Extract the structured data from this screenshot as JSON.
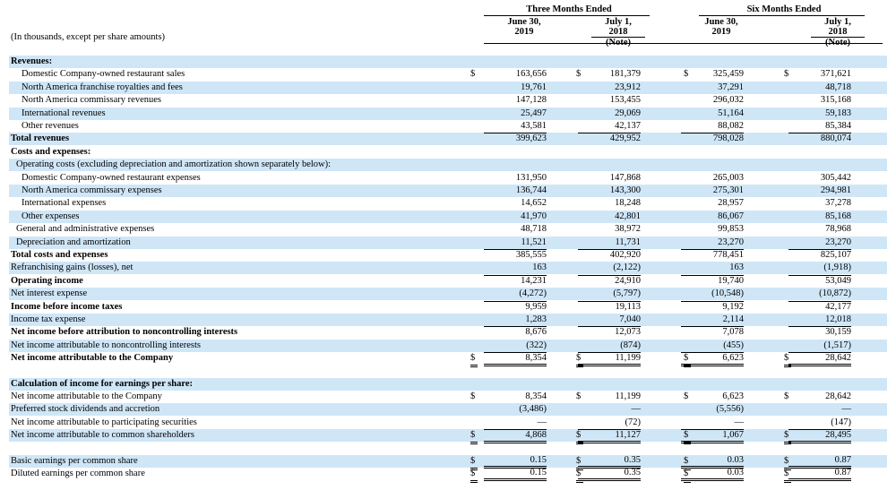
{
  "header": {
    "units": "(In thousands, except per share amounts)",
    "three_months": "Three Months Ended",
    "six_months": "Six Months Ended",
    "col1": [
      "June 30,",
      "2019",
      ""
    ],
    "col2": [
      "July 1,",
      "2018",
      "(Note)"
    ],
    "col3": [
      "June 30,",
      "2019",
      ""
    ],
    "col4": [
      "July 1,",
      "2018",
      "(Note)"
    ]
  },
  "rows": [
    {
      "label": "Revenues:",
      "indent": 0,
      "bold": true,
      "shade": true,
      "values": [
        "",
        "",
        "",
        ""
      ]
    },
    {
      "label": "Domestic Company-owned restaurant sales",
      "indent": 2,
      "shade": false,
      "dollar": true,
      "values": [
        "163,656",
        "181,379",
        "325,459",
        "371,621"
      ]
    },
    {
      "label": "North America franchise royalties and fees",
      "indent": 2,
      "shade": true,
      "values": [
        "19,761",
        "23,912",
        "37,291",
        "48,718"
      ]
    },
    {
      "label": "North America commissary revenues",
      "indent": 2,
      "shade": false,
      "values": [
        "147,128",
        "153,455",
        "296,032",
        "315,168"
      ]
    },
    {
      "label": "International revenues",
      "indent": 2,
      "shade": true,
      "values": [
        "25,497",
        "29,069",
        "51,164",
        "59,183"
      ]
    },
    {
      "label": "Other revenues",
      "indent": 2,
      "shade": false,
      "values": [
        "43,581",
        "42,137",
        "88,082",
        "85,384"
      ]
    },
    {
      "label": "Total revenues",
      "indent": 0,
      "bold": true,
      "shade": true,
      "top": true,
      "values": [
        "399,623",
        "429,952",
        "798,028",
        "880,074"
      ]
    },
    {
      "label": "Costs and expenses:",
      "indent": 0,
      "bold": true,
      "shade": false,
      "values": [
        "",
        "",
        "",
        ""
      ]
    },
    {
      "label": "Operating costs (excluding depreciation and amortization shown separately below):",
      "indent": 1,
      "shade": true,
      "values": [
        "",
        "",
        "",
        ""
      ]
    },
    {
      "label": "Domestic Company-owned restaurant expenses",
      "indent": 2,
      "shade": false,
      "values": [
        "131,950",
        "147,868",
        "265,003",
        "305,442"
      ]
    },
    {
      "label": "North America commissary expenses",
      "indent": 2,
      "shade": true,
      "values": [
        "136,744",
        "143,300",
        "275,301",
        "294,981"
      ]
    },
    {
      "label": "International expenses",
      "indent": 2,
      "shade": false,
      "values": [
        "14,652",
        "18,248",
        "28,957",
        "37,278"
      ]
    },
    {
      "label": "Other expenses",
      "indent": 2,
      "shade": true,
      "values": [
        "41,970",
        "42,801",
        "86,067",
        "85,168"
      ]
    },
    {
      "label": "General and administrative expenses",
      "indent": 1,
      "shade": false,
      "values": [
        "48,718",
        "38,972",
        "99,853",
        "78,968"
      ]
    },
    {
      "label": "Depreciation and amortization",
      "indent": 1,
      "shade": true,
      "values": [
        "11,521",
        "11,731",
        "23,270",
        "23,270"
      ]
    },
    {
      "label": "Total costs and expenses",
      "indent": 0,
      "bold": true,
      "shade": false,
      "top": true,
      "values": [
        "385,555",
        "402,920",
        "778,451",
        "825,107"
      ]
    },
    {
      "label": "Refranchising gains (losses), net",
      "indent": 0,
      "shade": true,
      "values": [
        "163",
        "(2,122)",
        "163",
        "(1,918)"
      ]
    },
    {
      "label": "Operating income",
      "indent": 0,
      "bold": true,
      "shade": false,
      "top": true,
      "values": [
        "14,231",
        "24,910",
        "19,740",
        "53,049"
      ]
    },
    {
      "label": "Net interest expense",
      "indent": 0,
      "shade": true,
      "values": [
        "(4,272)",
        "(5,797)",
        "(10,548)",
        "(10,872)"
      ]
    },
    {
      "label": "Income before income taxes",
      "indent": 0,
      "bold": true,
      "shade": false,
      "top": true,
      "values": [
        "9,959",
        "19,113",
        "9,192",
        "42,177"
      ]
    },
    {
      "label": "Income tax expense",
      "indent": 0,
      "shade": true,
      "values": [
        "1,283",
        "7,040",
        "2,114",
        "12,018"
      ]
    },
    {
      "label": "Net income before attribution to noncontrolling interests",
      "indent": 0,
      "bold": true,
      "shade": false,
      "top": true,
      "values": [
        "8,676",
        "12,073",
        "7,078",
        "30,159"
      ]
    },
    {
      "label": "Net income attributable to noncontrolling interests",
      "indent": 0,
      "shade": true,
      "values": [
        "(322)",
        "(874)",
        "(455)",
        "(1,517)"
      ]
    },
    {
      "label": "Net income attributable to the Company",
      "indent": 0,
      "bold": true,
      "shade": false,
      "top": true,
      "double": true,
      "dollar": true,
      "values": [
        "8,354",
        "11,199",
        "6,623",
        "28,642"
      ]
    },
    {
      "label": "",
      "indent": 0,
      "shade": false,
      "gap": true,
      "values": [
        "",
        "",
        "",
        ""
      ]
    },
    {
      "label": "Calculation of income for earnings per share:",
      "indent": 0,
      "bold": true,
      "shade": true,
      "values": [
        "",
        "",
        "",
        ""
      ]
    },
    {
      "label": "Net income attributable to the Company",
      "indent": 0,
      "shade": false,
      "dollar": true,
      "values": [
        "8,354",
        "11,199",
        "6,623",
        "28,642"
      ]
    },
    {
      "label": "Preferred stock dividends and accretion",
      "indent": 0,
      "shade": true,
      "values": [
        "(3,486)",
        "—",
        "(5,556)",
        "—"
      ]
    },
    {
      "label": "Net income attributable to participating securities",
      "indent": 0,
      "shade": false,
      "values": [
        "—",
        "(72)",
        "—",
        "(147)"
      ]
    },
    {
      "label": "Net income attributable to common shareholders",
      "indent": 0,
      "shade": true,
      "top": true,
      "double": true,
      "dollar": true,
      "values": [
        "4,868",
        "11,127",
        "1,067",
        "28,495"
      ]
    },
    {
      "label": "",
      "indent": 0,
      "shade": false,
      "gap": true,
      "values": [
        "",
        "",
        "",
        ""
      ]
    },
    {
      "label": "Basic earnings per common share",
      "indent": 0,
      "shade": true,
      "dollar": true,
      "double": true,
      "values": [
        "0.15",
        "0.35",
        "0.03",
        "0.87"
      ]
    },
    {
      "label": "Diluted earnings per common share",
      "indent": 0,
      "shade": false,
      "dollar": true,
      "double": true,
      "values": [
        "0.15",
        "0.35",
        "0.03",
        "0.87"
      ]
    }
  ],
  "currency_symbol": "$"
}
